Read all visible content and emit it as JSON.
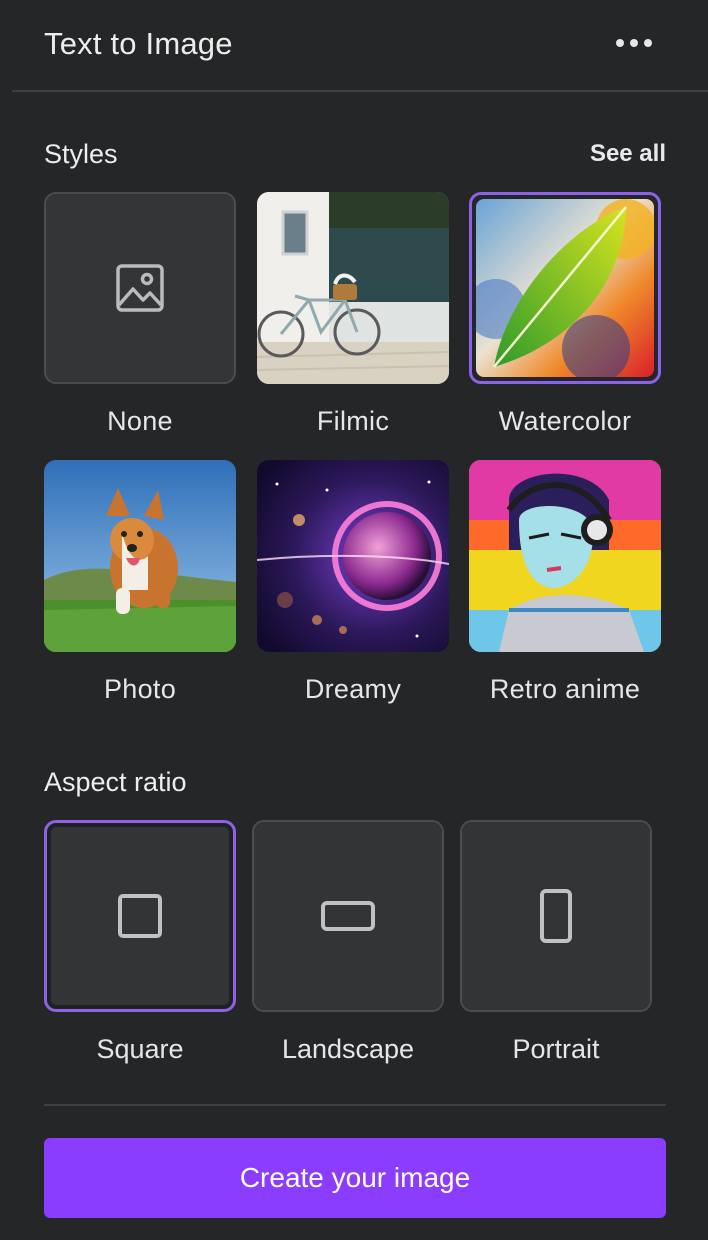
{
  "header": {
    "title": "Text to Image",
    "more_icon": "more-horizontal-icon"
  },
  "styles": {
    "title": "See all",
    "section_title": "Styles",
    "items": [
      {
        "label": "None",
        "icon": "image-icon",
        "selected": false
      },
      {
        "label": "Filmic",
        "selected": false
      },
      {
        "label": "Watercolor",
        "selected": true
      },
      {
        "label": "Photo",
        "selected": false
      },
      {
        "label": "Dreamy",
        "selected": false
      },
      {
        "label": "Retro anime",
        "selected": false
      }
    ]
  },
  "aspect_ratio": {
    "section_title": "Aspect ratio",
    "items": [
      {
        "label": "Square",
        "icon": "square-icon",
        "selected": true
      },
      {
        "label": "Landscape",
        "icon": "landscape-icon",
        "selected": false
      },
      {
        "label": "Portrait",
        "icon": "portrait-icon",
        "selected": false
      }
    ]
  },
  "actions": {
    "create_label": "Create your image"
  },
  "colors": {
    "background": "#252627",
    "accent": "#8b3dff",
    "selection": "#8b63e8",
    "card": "#343537"
  }
}
